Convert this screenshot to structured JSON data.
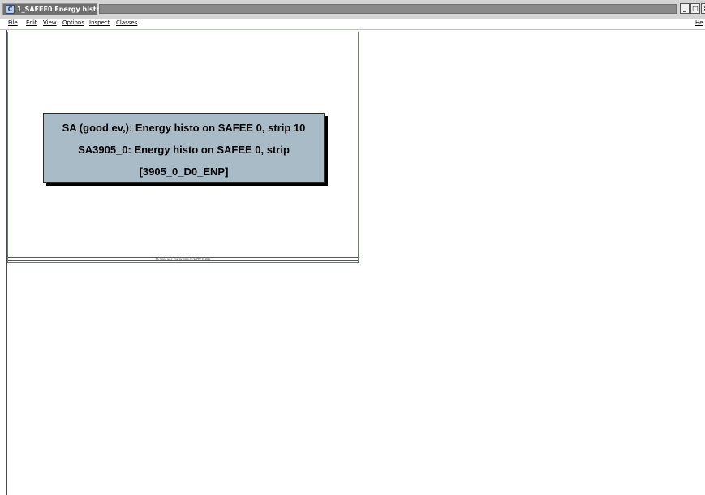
{
  "window": {
    "icon_glyph": "C",
    "title": "1_SAFEE0 Energy histo",
    "buttons": [
      "_",
      "□",
      "×"
    ]
  },
  "menu": {
    "items": [
      "File",
      "Edit",
      "View",
      "Options",
      "Inspect",
      "Classes"
    ],
    "right": "He"
  },
  "canvas": {
    "title_lines": [
      "SA (good ev,): Energy histo on SAFEE 0, strip 10",
      "SA3905_0: Energy histo on SAFEE 0, strip",
      "[3905_0_D0_ENP]"
    ],
    "footer": "SA (good ev,): Energy histo on SAFEE 0, strip"
  }
}
